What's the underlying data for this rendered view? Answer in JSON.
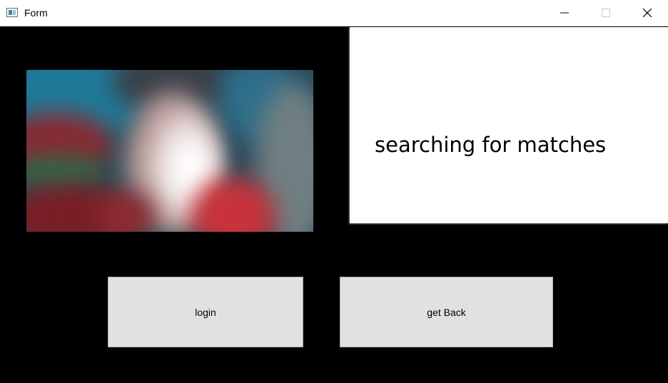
{
  "window": {
    "title": "Form",
    "icon": "form-window-icon",
    "controls": {
      "minimize_icon": "minimize-icon",
      "maximize_icon": "maximize-icon",
      "close_icon": "close-icon"
    }
  },
  "camera": {
    "content": "blurred live camera image"
  },
  "status": {
    "text": "searching for matches"
  },
  "buttons": {
    "login_label": "login",
    "back_label": "get Back"
  },
  "colors": {
    "background": "#000000",
    "panel": "#ffffff",
    "button_face": "#e1e1e1",
    "button_border": "#adadad"
  }
}
